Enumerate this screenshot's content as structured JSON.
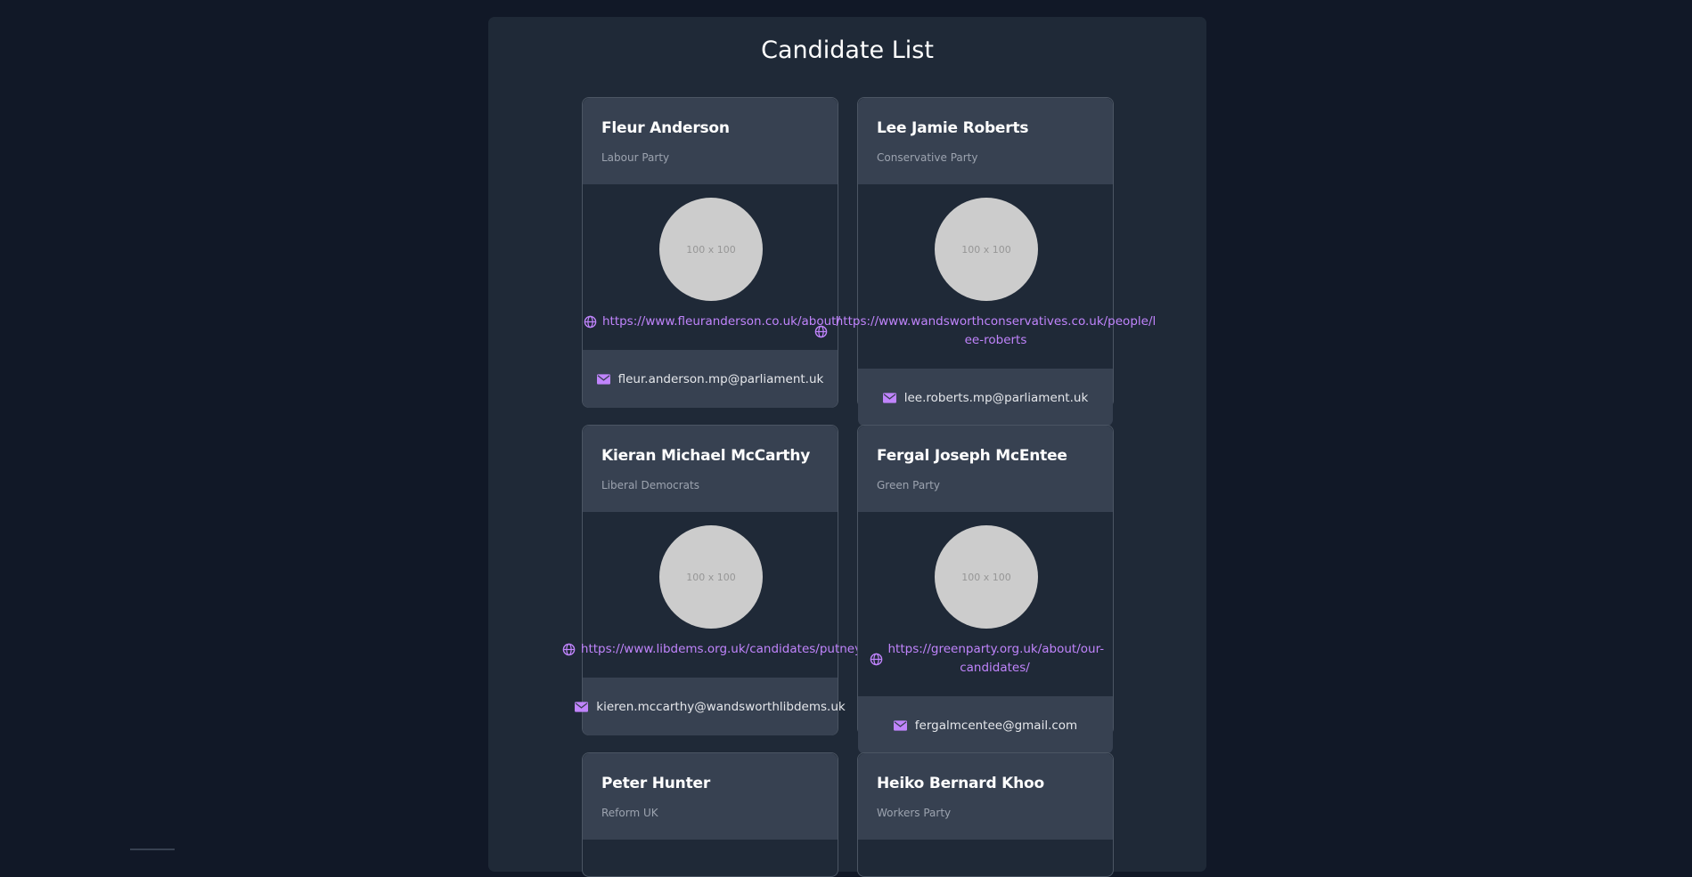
{
  "page": {
    "title": "Candidate List"
  },
  "candidates": [
    {
      "name": "Fleur Anderson",
      "party": "Labour Party",
      "photo": "100 x 100",
      "website": "https://www.fleuranderson.co.uk/about/",
      "email": "fleur.anderson.mp@parliament.uk"
    },
    {
      "name": "Lee Jamie Roberts",
      "party": "Conservative Party",
      "photo": "100 x 100",
      "website": "https://www.wandsworthconservatives.co.uk/people/lee-roberts",
      "email": "lee.roberts.mp@parliament.uk"
    },
    {
      "name": "Kieran Michael McCarthy",
      "party": "Liberal Democrats",
      "photo": "100 x 100",
      "website": "https://www.libdems.org.uk/candidates/putney",
      "email": "kieren.mccarthy@wandsworthlibdems.uk"
    },
    {
      "name": "Fergal Joseph McEntee",
      "party": "Green Party",
      "photo": "100 x 100",
      "website": "https://greenparty.org.uk/about/our-candidates/",
      "email": "fergalmcentee@gmail.com"
    },
    {
      "name": "Peter Hunter",
      "party": "Reform UK"
    },
    {
      "name": "Heiko Bernard Khoo",
      "party": "Workers Party"
    }
  ],
  "colors": {
    "background": "#111827",
    "panel": "#1f2937",
    "card_header": "#374151",
    "link": "#c084fc"
  },
  "icons": {
    "website": "globe-icon",
    "email": "envelope-icon"
  }
}
